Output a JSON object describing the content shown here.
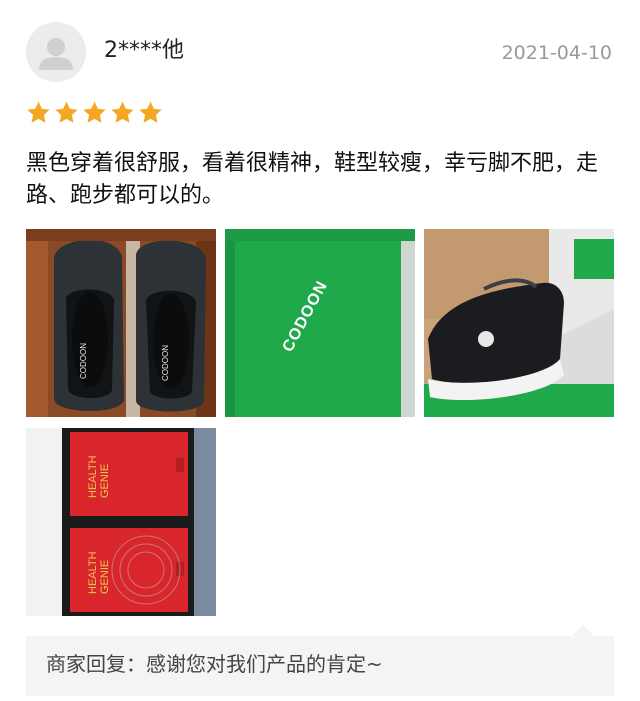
{
  "review": {
    "username": "2****他",
    "date": "2021-04-10",
    "rating": 5,
    "rating_max": 5,
    "star_color": "#F5A623",
    "text": "黑色穿着很舒服，看着很精神，鞋型较瘦，幸亏脚不肥，走路、跑步都可以的。",
    "photos": [
      {
        "brand": "CODOON",
        "brand_2": "CODOON"
      },
      {
        "brand": "CODOON"
      },
      {
        "brand": ""
      },
      {
        "label_1": "HEALTH",
        "label_2": "GENIE",
        "label_3": "HEALTH",
        "label_4": "GENIE"
      }
    ]
  },
  "reply": {
    "text": "商家回复：感谢您对我们产品的肯定~"
  },
  "colors": {
    "box_green": "#1FA94B",
    "box_red": "#D8262C",
    "reply_bg": "#F4F4F4",
    "date_gray": "#999999"
  }
}
